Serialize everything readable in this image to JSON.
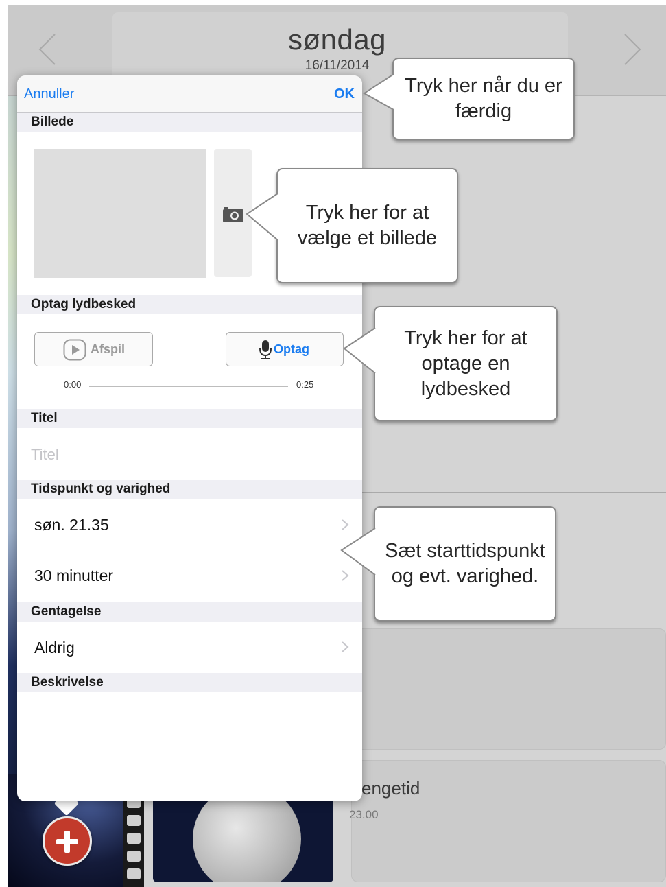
{
  "header": {
    "day_name": "søndag",
    "date": "16/11/2014"
  },
  "background": {
    "activity_title_fragment": "engetid",
    "activity_time": "23.00"
  },
  "popover": {
    "cancel_label": "Annuller",
    "ok_label": "OK",
    "sections": {
      "image": "Billede",
      "audio": "Optag lydbesked",
      "title": "Titel",
      "time": "Tidspunkt og varighed",
      "repeat": "Gentagelse",
      "description": "Beskrivelse"
    },
    "audio": {
      "play_label": "Afspil",
      "record_label": "Optag",
      "time_start": "0:00",
      "time_end": "0:25"
    },
    "title_field": {
      "value": "",
      "placeholder": "Titel"
    },
    "rows": {
      "start_time": "søn. 21.35",
      "duration": "30 minutter",
      "repeat": "Aldrig"
    }
  },
  "callouts": {
    "done": "Tryk her når du er færdig",
    "image": "Tryk her for at vælge et billede",
    "record": "Tryk her for at optage en lydbesked",
    "time": "Sæt starttidspunkt og evt. varighed."
  },
  "colors": {
    "accent": "#1a7cf0",
    "add_button": "#c23a2b",
    "section_background": "#efeff4"
  },
  "icons": [
    "chevron-left-icon",
    "chevron-right-icon",
    "camera-icon",
    "play-icon",
    "microphone-icon",
    "plus-icon"
  ]
}
